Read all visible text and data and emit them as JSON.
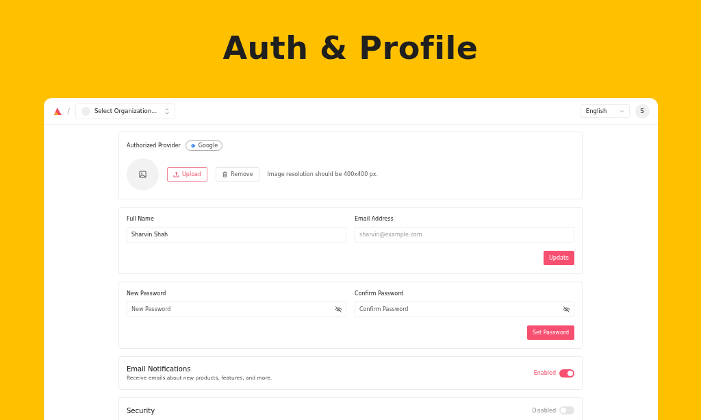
{
  "headline": "Auth & Profile",
  "topbar": {
    "breadcrumb_separator": "/",
    "organization_select": {
      "placeholder": "Select Organization..."
    },
    "language_select": {
      "value": "English"
    },
    "avatar": {
      "initial": "S"
    }
  },
  "provider_card": {
    "label": "Authorized Provider",
    "provider": "Google",
    "upload_button": "Upload",
    "remove_button": "Remove",
    "hint": "Image resolution should be 400x400 px."
  },
  "profile_card": {
    "fields": [
      {
        "label": "Full Name",
        "value": "Sharvin Shah"
      },
      {
        "label": "Email Address",
        "placeholder": "sharvin@example.com"
      }
    ],
    "button": "Update"
  },
  "password_card": {
    "fields": [
      {
        "label": "New Password",
        "placeholder": "New Password"
      },
      {
        "label": "Confirm Password",
        "placeholder": "Confirm Password"
      }
    ],
    "button": "Set Password"
  },
  "settings": [
    {
      "kind": "toggle",
      "title": "Email Notifications",
      "description": "Receive emails about new products, features, and more.",
      "status": "Enabled",
      "on": true
    },
    {
      "kind": "toggle",
      "title": "Security",
      "status": "Disabled",
      "on": false
    }
  ]
}
